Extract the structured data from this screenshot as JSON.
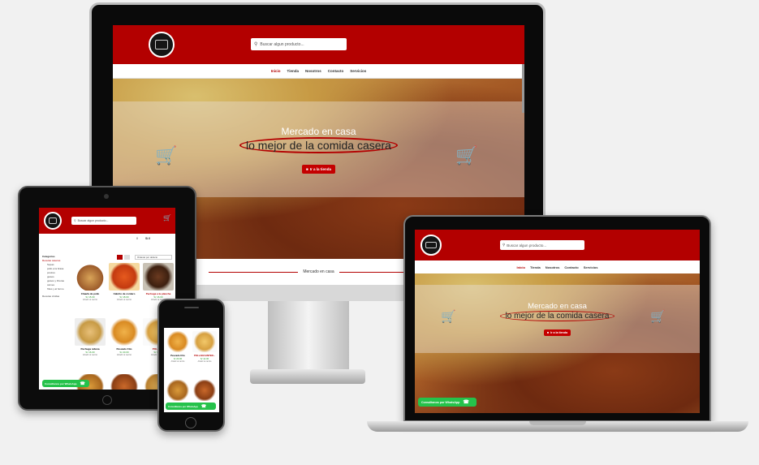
{
  "site": {
    "search_placeholder": "Buscar algun producto...",
    "nav": [
      "Inicio",
      "Tienda",
      "Nosotros",
      "Contacto",
      "Servicios"
    ],
    "hero_title": "Mercado en casa",
    "hero_subtitle": "lo mejor de la comida casera",
    "shop_button": "Ir a la tienda",
    "section_heading": "Mercado en casa",
    "whatsapp": "Consúltanos por WhatsApp",
    "cart_count": "0",
    "currency": "S/.0"
  },
  "tablet": {
    "categories_title": "Categorías",
    "categories": [
      "Recetas caseras",
      "Sopas",
      "pollo a la brasa",
      "postres",
      "guisos",
      "guisos y frituras",
      "carnes",
      "fritos y al horno"
    ],
    "categories_extra": "Recetas criollas",
    "sort_label": "Ordenar por defecto",
    "products_row1": [
      {
        "name": "Chaufa de pollo",
        "price": "S/ 15.00",
        "meta": "Añadir al carrito"
      },
      {
        "name": "Cabrito de cordero",
        "price": "S/ 18.00",
        "meta": "Añadir al carrito"
      },
      {
        "name": "Pechuga a la plancha",
        "price": "S/ 16.00",
        "meta": "Añadir al carrito"
      }
    ],
    "products_row2": [
      {
        "name": "Pechuga rellena",
        "price": "S/ 16.00",
        "meta": "Añadir al carrito"
      },
      {
        "name": "Pescado frito",
        "price": "S/ 20.00",
        "meta": "Añadir al carrito"
      },
      {
        "name": "POLLADA",
        "price": "S/ 14.00",
        "meta": "Añadir al carrito"
      }
    ]
  },
  "phone": {
    "products": [
      {
        "name": "Pescado frito",
        "price": "S/ 20.00",
        "meta": "Añadir al carrito"
      },
      {
        "name": "POLLADA ENTER...",
        "price": "S/ 14.00",
        "meta": "Añadir al carrito"
      }
    ]
  },
  "colors": {
    "brand_red": "#b30000",
    "whatsapp_green": "#25c24b"
  },
  "icons": [
    "search-icon",
    "cart-icon",
    "whatsapp-icon",
    "store-icon",
    "grid-icon",
    "list-icon"
  ]
}
